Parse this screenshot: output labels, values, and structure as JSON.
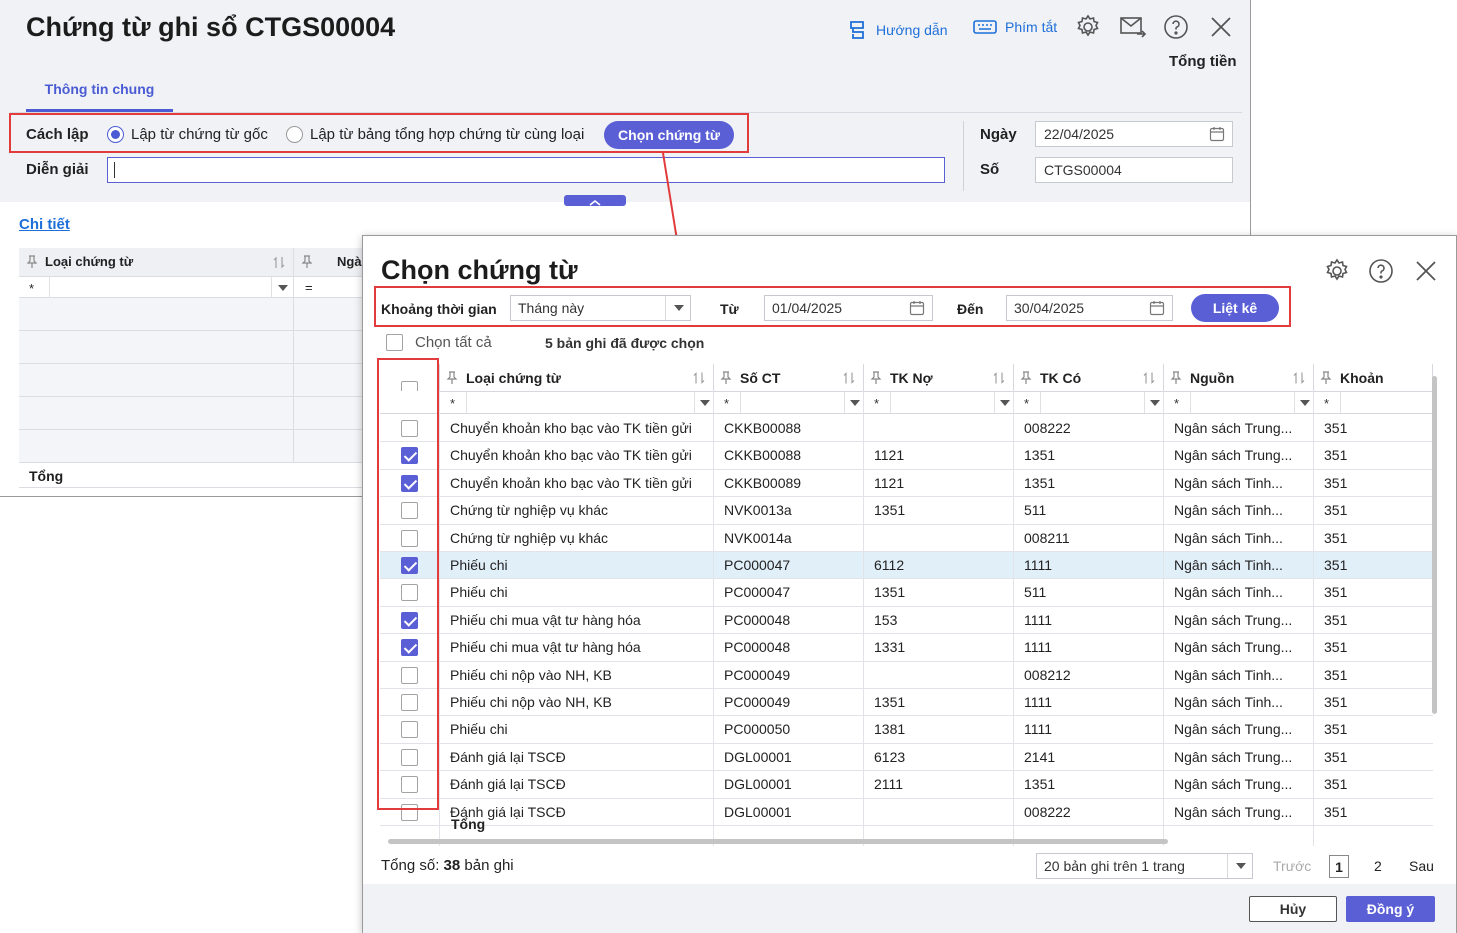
{
  "main_window": {
    "title": "Chứng từ ghi sổ CTGS00004",
    "toolbar": {
      "guide": "Hướng dẫn",
      "shortcuts": "Phím tắt"
    },
    "total_money_label": "Tổng tiền",
    "tab": "Thông tin chung",
    "method_label": "Cách lập",
    "method_options": [
      "Lập từ chứng từ gốc",
      "Lập từ bảng tổng hợp chứng từ cùng loại"
    ],
    "choose_button": "Chọn chứng từ",
    "description_label": "Diễn giải",
    "description_value": "",
    "date_label": "Ngày",
    "date_value": "22/04/2025",
    "number_label": "Số",
    "number_value": "CTGS00004",
    "detail_link": "Chi tiết",
    "grid_headers": [
      "Loại chứng từ",
      "Ngà"
    ],
    "grid_filter_ops": [
      "*",
      "="
    ],
    "total_row": "Tổng"
  },
  "dialog": {
    "title": "Chọn chứng từ",
    "filter": {
      "period_label": "Khoảng thời gian",
      "period_value": "Tháng này",
      "from_label": "Từ",
      "from_value": "01/04/2025",
      "to_label": "Đến",
      "to_value": "30/04/2025",
      "list_button": "Liệt kê"
    },
    "select_all": "Chọn tất cả",
    "selected_count": "5 bản ghi đã được chọn",
    "columns": [
      "Loại chứng từ",
      "Số CT",
      "TK Nợ",
      "TK Có",
      "Nguồn",
      "Khoản"
    ],
    "filter_placeholder": "*",
    "rows": [
      {
        "type": "Chuyển khoản kho bạc vào TK tiền gửi",
        "no": "CKKB00088",
        "debit": "",
        "credit": "008222",
        "source": "Ngân sách Trung...",
        "item": "351",
        "checked": false
      },
      {
        "type": "Chuyển khoản kho bạc vào TK tiền gửi",
        "no": "CKKB00088",
        "debit": "1121",
        "credit": "1351",
        "source": "Ngân sách Trung...",
        "item": "351",
        "checked": true
      },
      {
        "type": "Chuyển khoản kho bạc vào TK tiền gửi",
        "no": "CKKB00089",
        "debit": "1121",
        "credit": "1351",
        "source": "Ngân sách Tinh...",
        "item": "351",
        "checked": true
      },
      {
        "type": "Chứng từ nghiệp vụ khác",
        "no": "NVK0013a",
        "debit": "1351",
        "credit": "511",
        "source": "Ngân sách Tinh...",
        "item": "351",
        "checked": false
      },
      {
        "type": "Chứng từ nghiệp vụ khác",
        "no": "NVK0014a",
        "debit": "",
        "credit": "008211",
        "source": "Ngân sách Tinh...",
        "item": "351",
        "checked": false
      },
      {
        "type": "Phiếu chi",
        "no": "PC000047",
        "debit": "6112",
        "credit": "1111",
        "source": "Ngân sách Tinh...",
        "item": "351",
        "checked": true
      },
      {
        "type": "Phiếu chi",
        "no": "PC000047",
        "debit": "1351",
        "credit": "511",
        "source": "Ngân sách Tinh...",
        "item": "351",
        "checked": false
      },
      {
        "type": "Phiếu chi mua vật tư hàng hóa",
        "no": "PC000048",
        "debit": "153",
        "credit": "1111",
        "source": "Ngân sách Trung...",
        "item": "351",
        "checked": true
      },
      {
        "type": "Phiếu chi mua vật tư hàng hóa",
        "no": "PC000048",
        "debit": "1331",
        "credit": "1111",
        "source": "Ngân sách Trung...",
        "item": "351",
        "checked": true
      },
      {
        "type": "Phiếu chi nộp vào NH, KB",
        "no": "PC000049",
        "debit": "",
        "credit": "008212",
        "source": "Ngân sách Tinh...",
        "item": "351",
        "checked": false
      },
      {
        "type": "Phiếu chi nộp vào NH, KB",
        "no": "PC000049",
        "debit": "1351",
        "credit": "1111",
        "source": "Ngân sách Tinh...",
        "item": "351",
        "checked": false
      },
      {
        "type": "Phiếu chi",
        "no": "PC000050",
        "debit": "1381",
        "credit": "1111",
        "source": "Ngân sách Trung...",
        "item": "351",
        "checked": false
      },
      {
        "type": "Đánh giá lại TSCĐ",
        "no": "DGL00001",
        "debit": "6123",
        "credit": "2141",
        "source": "Ngân sách Trung...",
        "item": "351",
        "checked": false
      },
      {
        "type": "Đánh giá lại TSCĐ",
        "no": "DGL00001",
        "debit": "2111",
        "credit": "1351",
        "source": "Ngân sách Trung...",
        "item": "351",
        "checked": false
      },
      {
        "type": "Đánh giá lại TSCĐ",
        "no": "DGL00001",
        "debit": "",
        "credit": "008222",
        "source": "Ngân sách Trung...",
        "item": "351",
        "checked": false
      }
    ],
    "total_row": "Tổng",
    "record_total_label": "Tổng số:",
    "record_total_value": "38",
    "record_total_unit": "bản ghi",
    "page_size": "20 bản ghi trên 1 trang",
    "pagination": {
      "prev": "Trước",
      "page1": "1",
      "page2": "2",
      "next": "Sau"
    },
    "cancel_button": "Hủy",
    "ok_button": "Đồng ý",
    "highlight_color": "#e23b3b",
    "accent_color": "#5b5fd6"
  }
}
